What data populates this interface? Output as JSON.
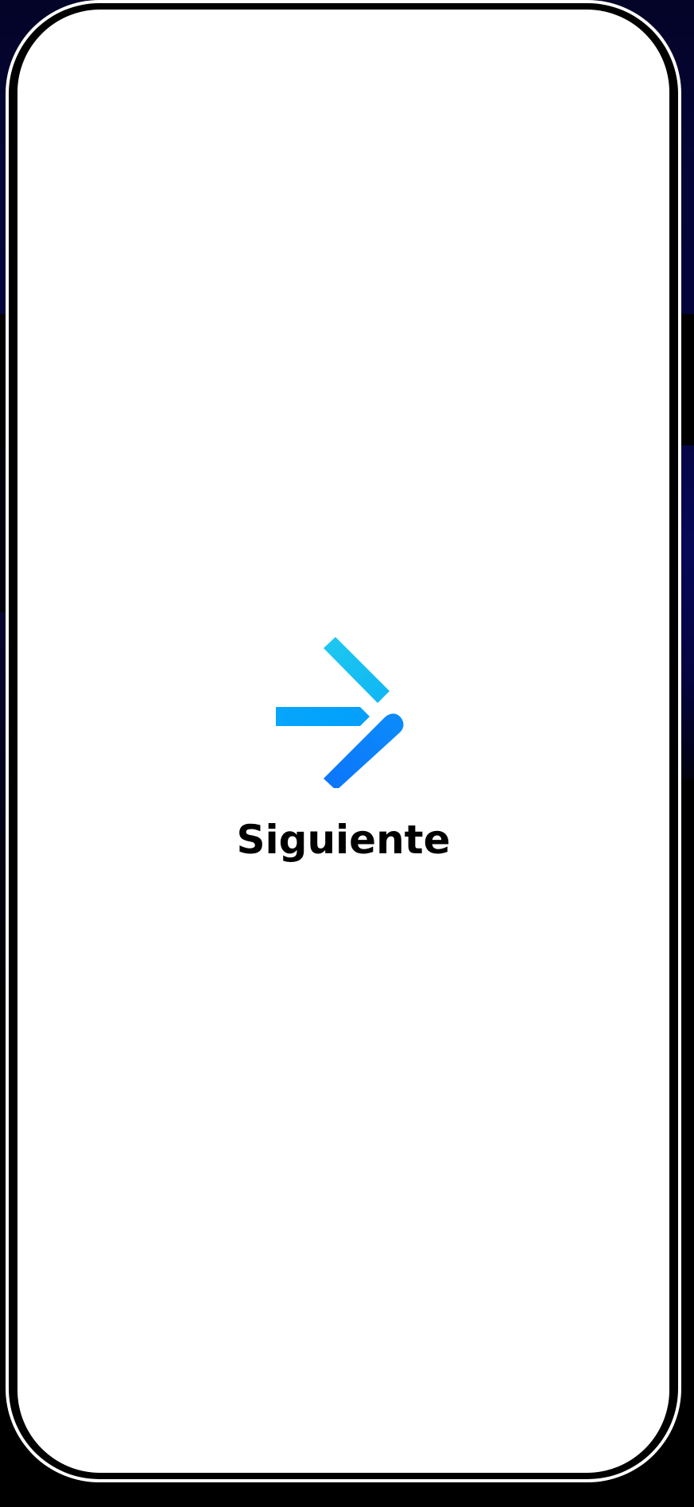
{
  "app": {
    "brand_name": "Siguiente",
    "logo_icon": "arrow-right-chevron-icon"
  },
  "colors": {
    "background": "#000000",
    "background_accent": "#050539",
    "screen": "#ffffff",
    "text": "#000000",
    "logo_light": "#1ac8f0",
    "logo_mid": "#05a4fb",
    "logo_dark": "#0c7dfa"
  }
}
